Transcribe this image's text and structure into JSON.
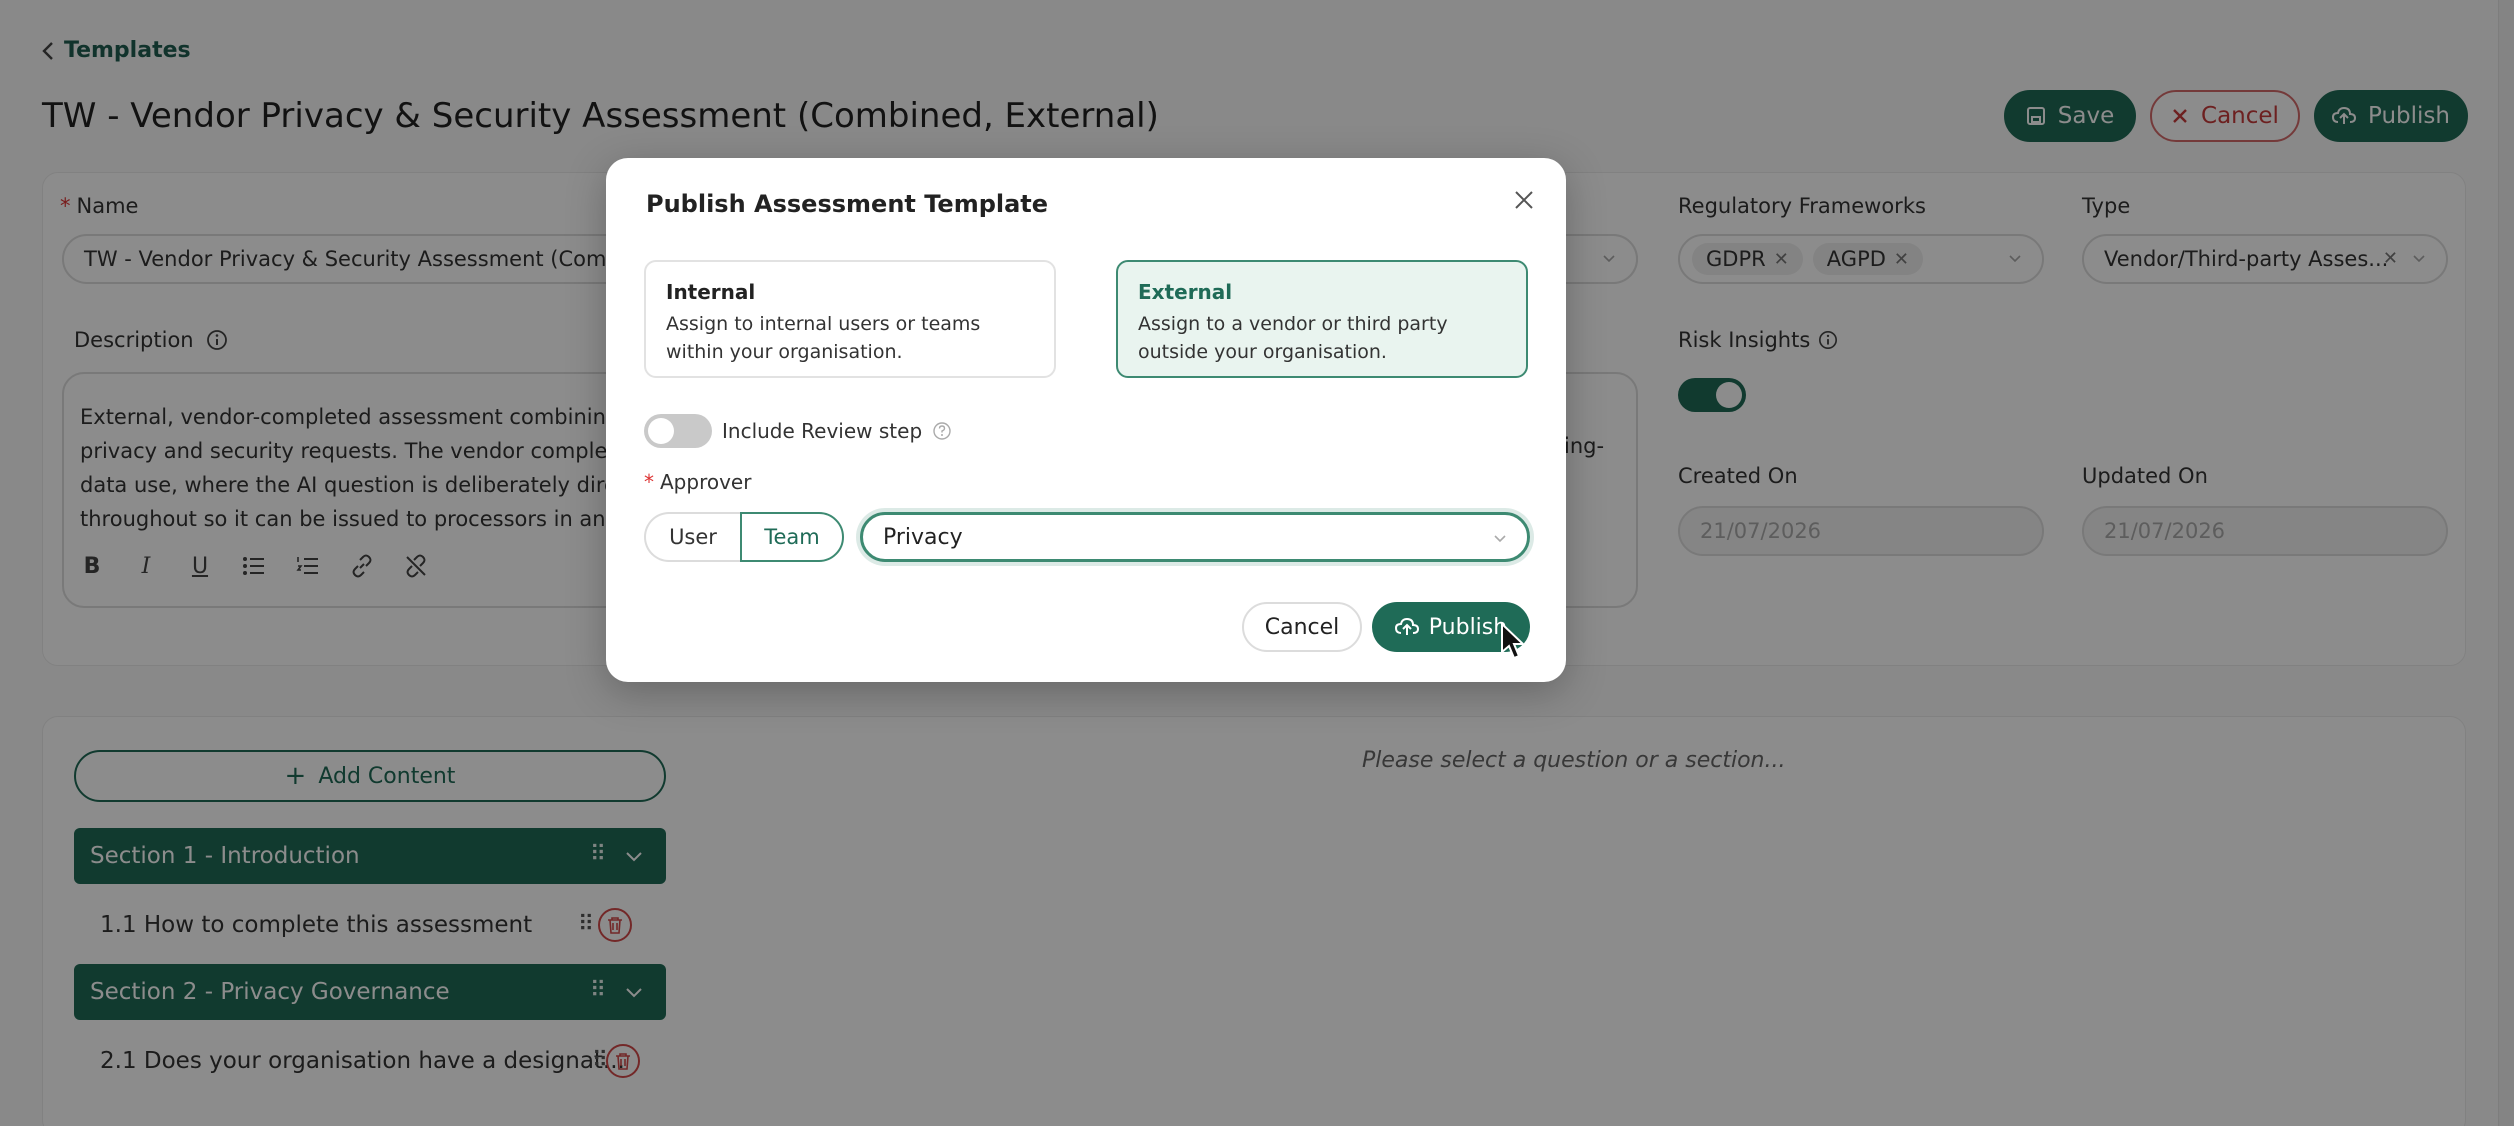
{
  "breadcrumb": {
    "label": "Templates"
  },
  "page": {
    "title": "TW - Vendor Privacy & Security Assessment (Combined, External)"
  },
  "header_actions": {
    "save": "Save",
    "cancel": "Cancel",
    "publish": "Publish"
  },
  "form": {
    "name_label": "Name",
    "name_value": "TW - Vendor Privacy & Security Assessment (Combin",
    "description_label": "Description",
    "description_lines": [
      "External, vendor-completed assessment combining pr",
      "privacy and security requests. The vendor completes",
      "data use, where the AI question is deliberately directiv",
      "throughout so it can be issued to processors in any re"
    ],
    "description_right_fragment": "ing-",
    "regulatory_label": "Regulatory Frameworks",
    "regulatory_tags": [
      "GDPR",
      "AGPD"
    ],
    "type_label": "Type",
    "type_value": "Vendor/Third-party Asses...",
    "risk_insights_label": "Risk Insights",
    "risk_insights_on": true,
    "created_label": "Created On",
    "created_value": "21/07/2026",
    "updated_label": "Updated On",
    "updated_value": "21/07/2026"
  },
  "builder": {
    "add_content": "Add Content",
    "empty_hint": "Please select a question or a section...",
    "items": [
      {
        "kind": "section",
        "label": "Section 1 - Introduction"
      },
      {
        "kind": "question",
        "label": "1.1 How to complete this assessment"
      },
      {
        "kind": "section",
        "label": "Section 2 - Privacy Governance"
      },
      {
        "kind": "question",
        "label": "2.1 Does your organisation have a designat..."
      }
    ]
  },
  "modal": {
    "title": "Publish Assessment Template",
    "internal": {
      "title": "Internal",
      "desc": "Assign to internal users or teams within your organisation."
    },
    "external": {
      "title": "External",
      "desc": "Assign to a vendor or third party outside your organisation."
    },
    "selected_option": "External",
    "review_step_label": "Include Review step",
    "review_step_on": false,
    "approver_label": "Approver",
    "approver_tabs": [
      "User",
      "Team"
    ],
    "approver_tab_selected": "Team",
    "approver_value": "Privacy",
    "cancel": "Cancel",
    "publish": "Publish"
  },
  "colors": {
    "primary": "#1f6b57",
    "danger": "#c63b3b",
    "selected_bg": "#e9f4ef"
  }
}
